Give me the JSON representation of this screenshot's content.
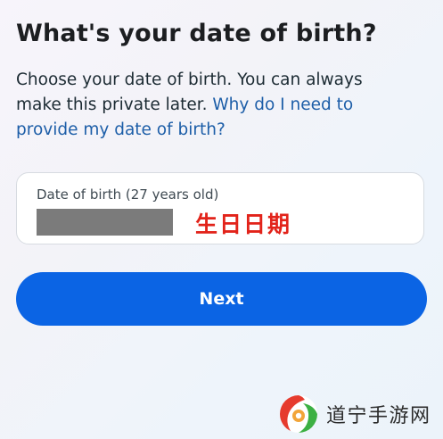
{
  "header": {
    "title": "What's your date of birth?"
  },
  "description": {
    "text": "Choose your date of birth. You can always make this private later. ",
    "link_text": "Why do I need to provide my date of birth?"
  },
  "dob_field": {
    "label": "Date of birth (27 years old)",
    "value_redacted": true,
    "overlay_caption": "生日日期",
    "overlay_caption_color": "#e2231a"
  },
  "actions": {
    "next_label": "Next"
  },
  "watermark": {
    "text": "道宁手游网"
  },
  "colors": {
    "primary": "#0b64e4",
    "link": "#1d5ea8",
    "redaction": "#7b7b7b",
    "logo_red": "#e63b2e",
    "logo_green": "#3cb043"
  }
}
